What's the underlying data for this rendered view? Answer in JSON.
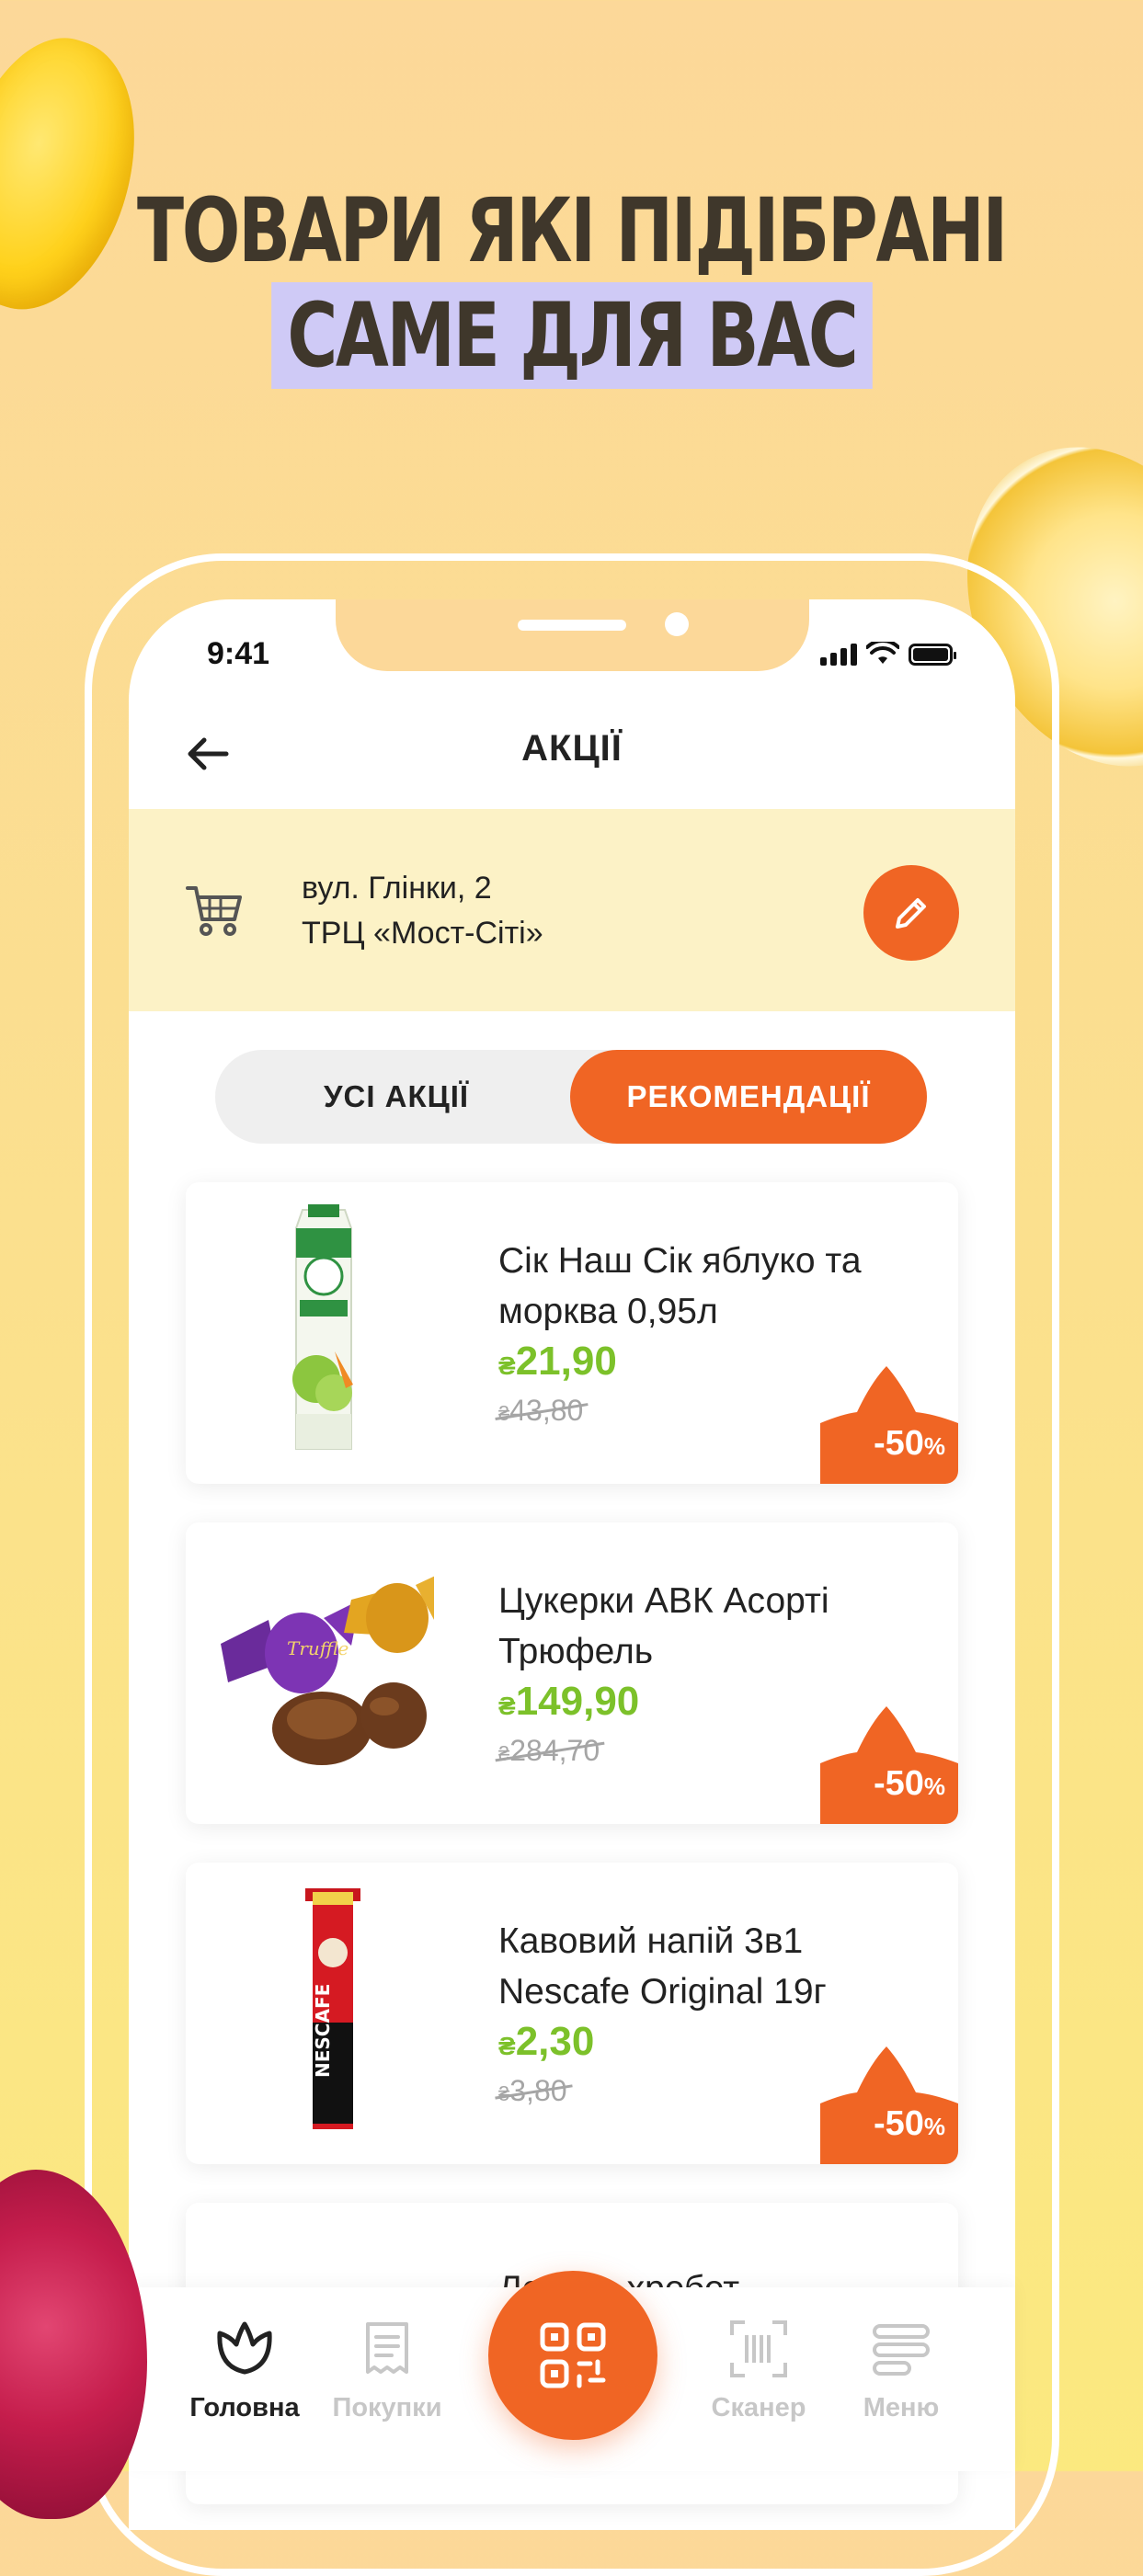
{
  "headline": {
    "line1": "ТОВАРИ ЯКІ ПІДІБРАНІ",
    "line2": "САМЕ ДЛЯ ВАС"
  },
  "status_bar": {
    "time": "9:41"
  },
  "nav": {
    "title": "АКЦІЇ",
    "back_icon": "arrow-left-icon"
  },
  "store": {
    "address_line1": "вул. Глінки, 2",
    "address_line2": "ТРЦ «Мост-Сіті»",
    "cart_icon": "cart-icon",
    "edit_icon": "pencil-icon"
  },
  "segments": {
    "all": "УСІ АКЦІЇ",
    "recommended": "РЕКОМЕНДАЦІЇ",
    "selected": "recommended"
  },
  "products": [
    {
      "name": "Сік Наш Сік яблуко та морква 0,95л",
      "price": "21,90",
      "old_price": "43,80",
      "discount": "-50",
      "currency": "₴"
    },
    {
      "name": "Цукерки АВК Асорті Трюфель",
      "price": "149,90",
      "old_price": "284,70",
      "discount": "-50",
      "currency": "₴"
    },
    {
      "name": "Кавовий напій 3в1 Nescafe Original 19г",
      "price": "2,30",
      "old_price": "3,80",
      "discount": "-50",
      "currency": "₴"
    },
    {
      "name": "Лосось хребет",
      "price": "",
      "old_price": "",
      "discount": "",
      "currency": ""
    }
  ],
  "tabbar": {
    "home": "Головна",
    "purchases": "Покупки",
    "scanner": "Сканер",
    "menu": "Меню",
    "fab_icon": "qr-code-icon"
  },
  "colors": {
    "accent": "#f06524",
    "price": "#7cc12a",
    "address_bg": "#fcf2c6",
    "headline_highlight": "#cfcaf6"
  }
}
